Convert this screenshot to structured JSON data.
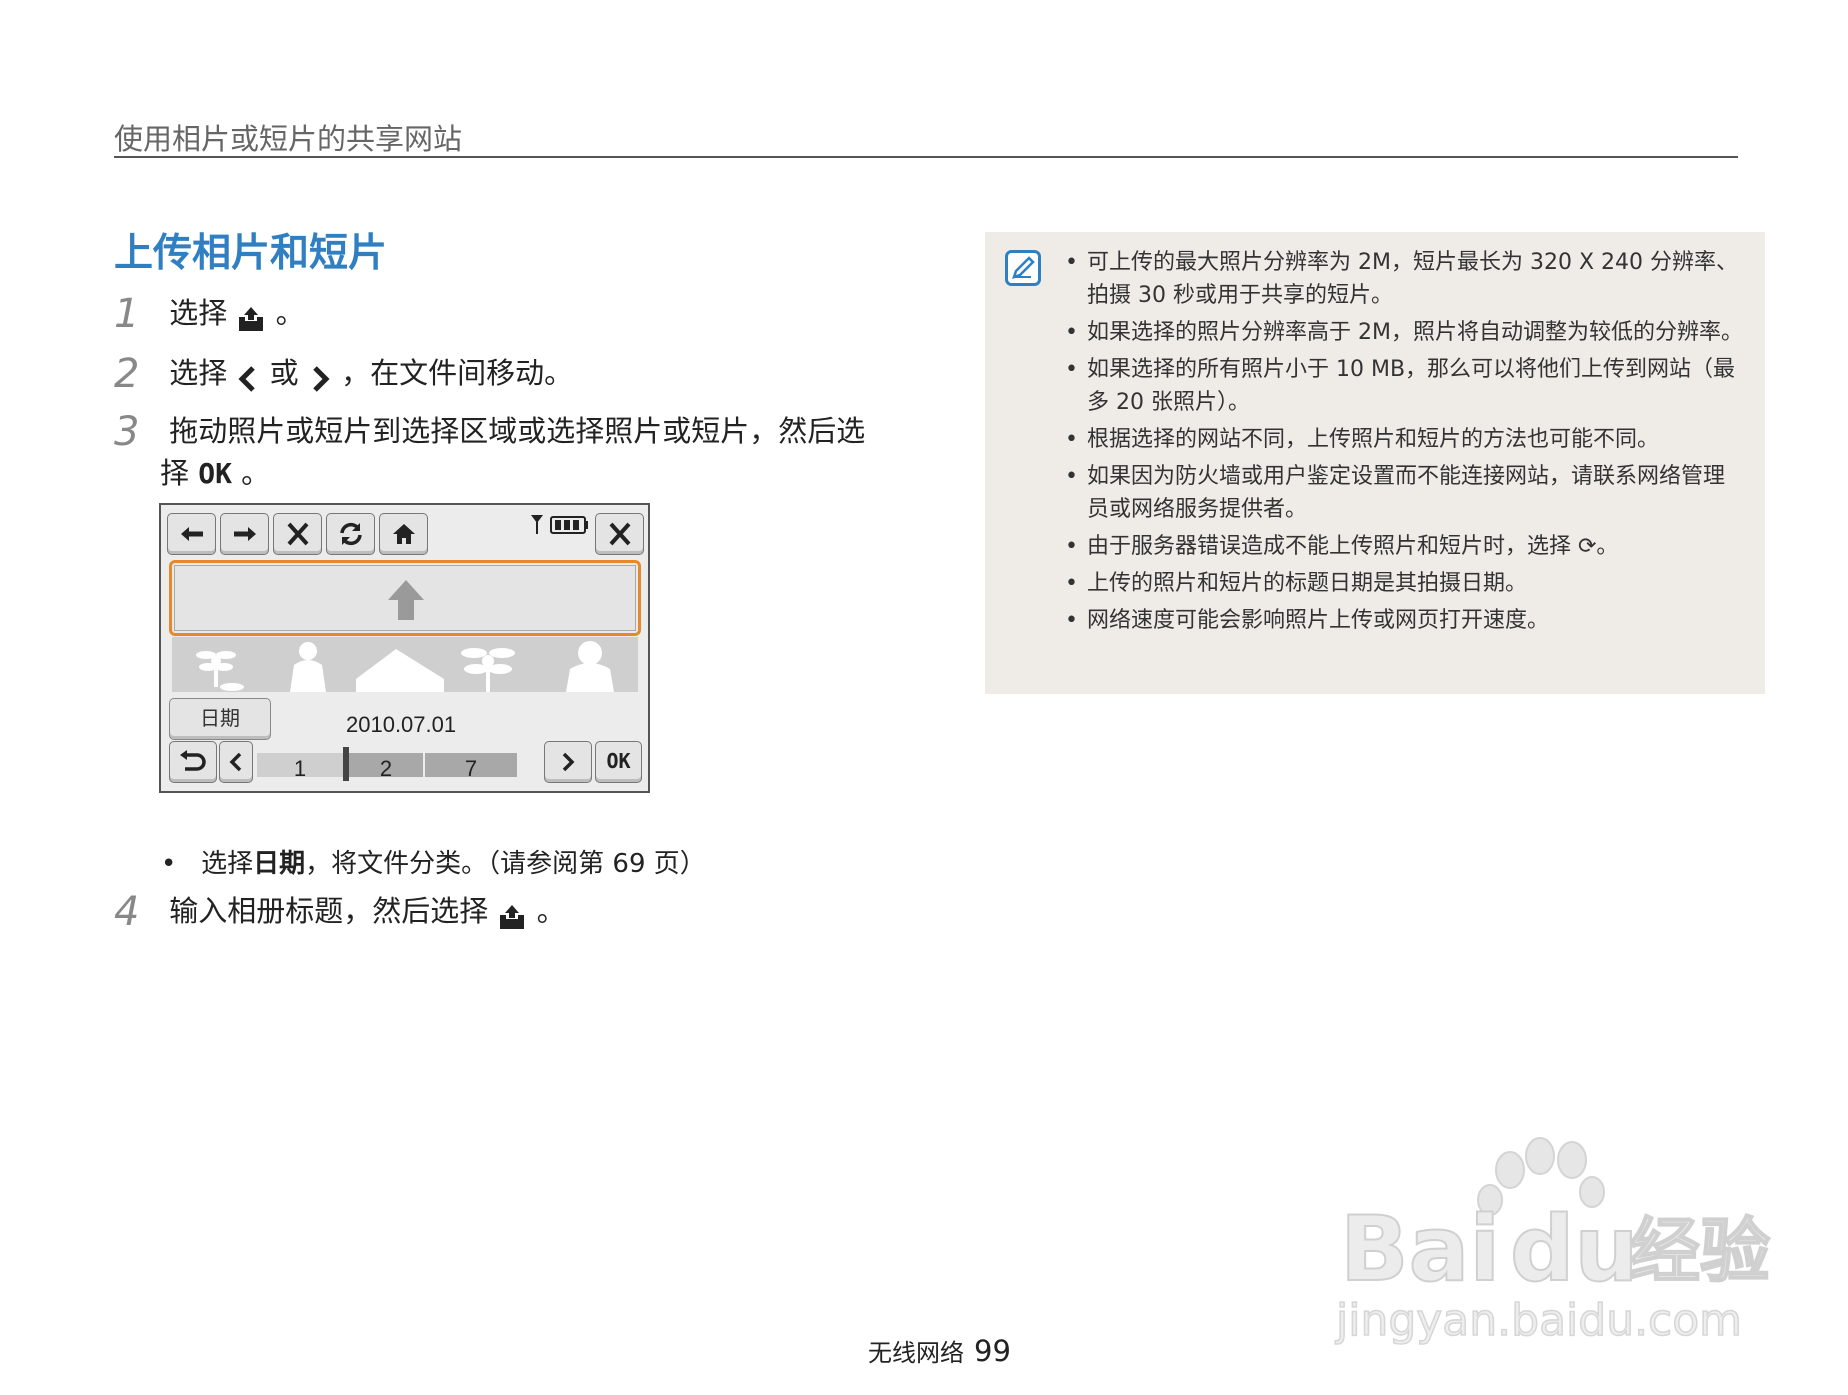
{
  "header": {
    "title": "使用相片或短片的共享网站"
  },
  "section": {
    "title": "上传相片和短片"
  },
  "steps": [
    {
      "num": "1",
      "text_a": "选择",
      "text_b": "。"
    },
    {
      "num": "2",
      "text_a": "选择",
      "text_b": "或",
      "text_c": "，在文件间移动。"
    },
    {
      "num": "3",
      "text_a": "拖动照片或短片到选择区域或选择照片或短片，然后选",
      "text_b": "择",
      "text_c": "OK",
      "text_d": "。"
    },
    {
      "num": "4",
      "text_a": "输入相册标题，然后选择",
      "text_b": "。"
    }
  ],
  "camera_screen": {
    "toolbar_icons": [
      "back-arrow-icon",
      "forward-arrow-icon",
      "delete-x-icon",
      "refresh-icon",
      "home-icon"
    ],
    "close_icon": "close-icon",
    "status_icons": [
      "signal-icon",
      "battery-icon"
    ],
    "upload_icon": "upload-arrow-icon",
    "date_button": "日期",
    "date_value": "2010.07.01",
    "pages": [
      "1",
      "2",
      "7"
    ],
    "ok_label": "OK",
    "colors": {
      "highlight": "#e58a2c"
    }
  },
  "bullet": {
    "pre": "选择",
    "bold": "日期",
    "post": "，将文件分类。（请参阅第 69 页）"
  },
  "note": {
    "icon": "note-pen-icon",
    "items": [
      "可上传的最大照片分辨率为 2M，短片最长为 320 X 240 分辨率、拍摄 30 秒或用于共享的短片。",
      "如果选择的照片分辨率高于 2M，照片将自动调整为较低的分辨率。",
      "如果选择的所有照片小于 10 MB，那么可以将他们上传到网站（最多 20 张照片）。",
      "根据选择的网站不同，上传照片和短片的方法也可能不同。",
      "如果因为防火墙或用户鉴定设置而不能连接网站，请联系网络管理员或网络服务提供者。",
      "由于服务器错误造成不能上传照片和短片时，选择 ⟳。",
      "上传的照片和短片的标题日期是其拍摄日期。",
      "网络速度可能会影响照片上传或网页打开速度。"
    ]
  },
  "footer": {
    "section": "无线网络",
    "page": "99"
  },
  "watermark": {
    "brand": "Baidu",
    "sub": "经验",
    "url": "jingyan.baidu.com"
  },
  "colors": {
    "accent": "#2f7fc2",
    "note_bg": "#efece8"
  }
}
